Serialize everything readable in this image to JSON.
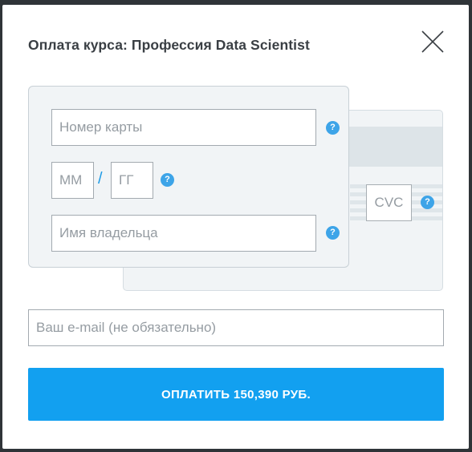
{
  "modal": {
    "title": "Оплата курса: Профессия Data Scientist"
  },
  "card_front": {
    "card_number_placeholder": "Номер карты",
    "month_placeholder": "ММ",
    "year_placeholder": "ГГ",
    "separator": "/",
    "holder_placeholder": "Имя владельца",
    "help_symbol": "?"
  },
  "card_back": {
    "cvc_placeholder": "CVC",
    "help_symbol": "?"
  },
  "email": {
    "placeholder": "Ваш e-mail (не обязательно)"
  },
  "pay_button": {
    "label": "ОПЛАТИТЬ 150,390 РУБ."
  },
  "icons": {
    "close": "close-icon",
    "help": "help-icon"
  },
  "colors": {
    "accent": "#12a0f0",
    "help_icon": "#3da4e8",
    "card_bg": "#f1f4f6",
    "title_text": "#3a3f44"
  }
}
